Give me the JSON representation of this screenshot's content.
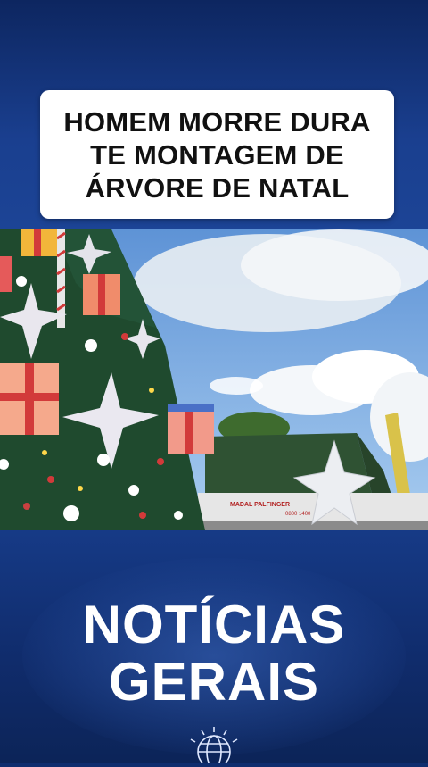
{
  "headline": {
    "lines": [
      "HOMEM MORRE DURA",
      "TE MONTAGEM DE",
      "ÁRVORE DE NATAL"
    ]
  },
  "brand": {
    "line1": "NOTÍCIAS",
    "line2": "GERAIS"
  },
  "photo": {
    "truck_label": "MADAL PALFINGER",
    "truck_phone": "0800 1400"
  },
  "icons": {
    "brand_icon": "globe-icon"
  },
  "colors": {
    "background": "#0f2d6e",
    "card": "#ffffff",
    "text_dark": "#111111",
    "brand_text": "#ffffff",
    "tree_green": "#1f4a2e",
    "sky": "#87b6e8"
  }
}
